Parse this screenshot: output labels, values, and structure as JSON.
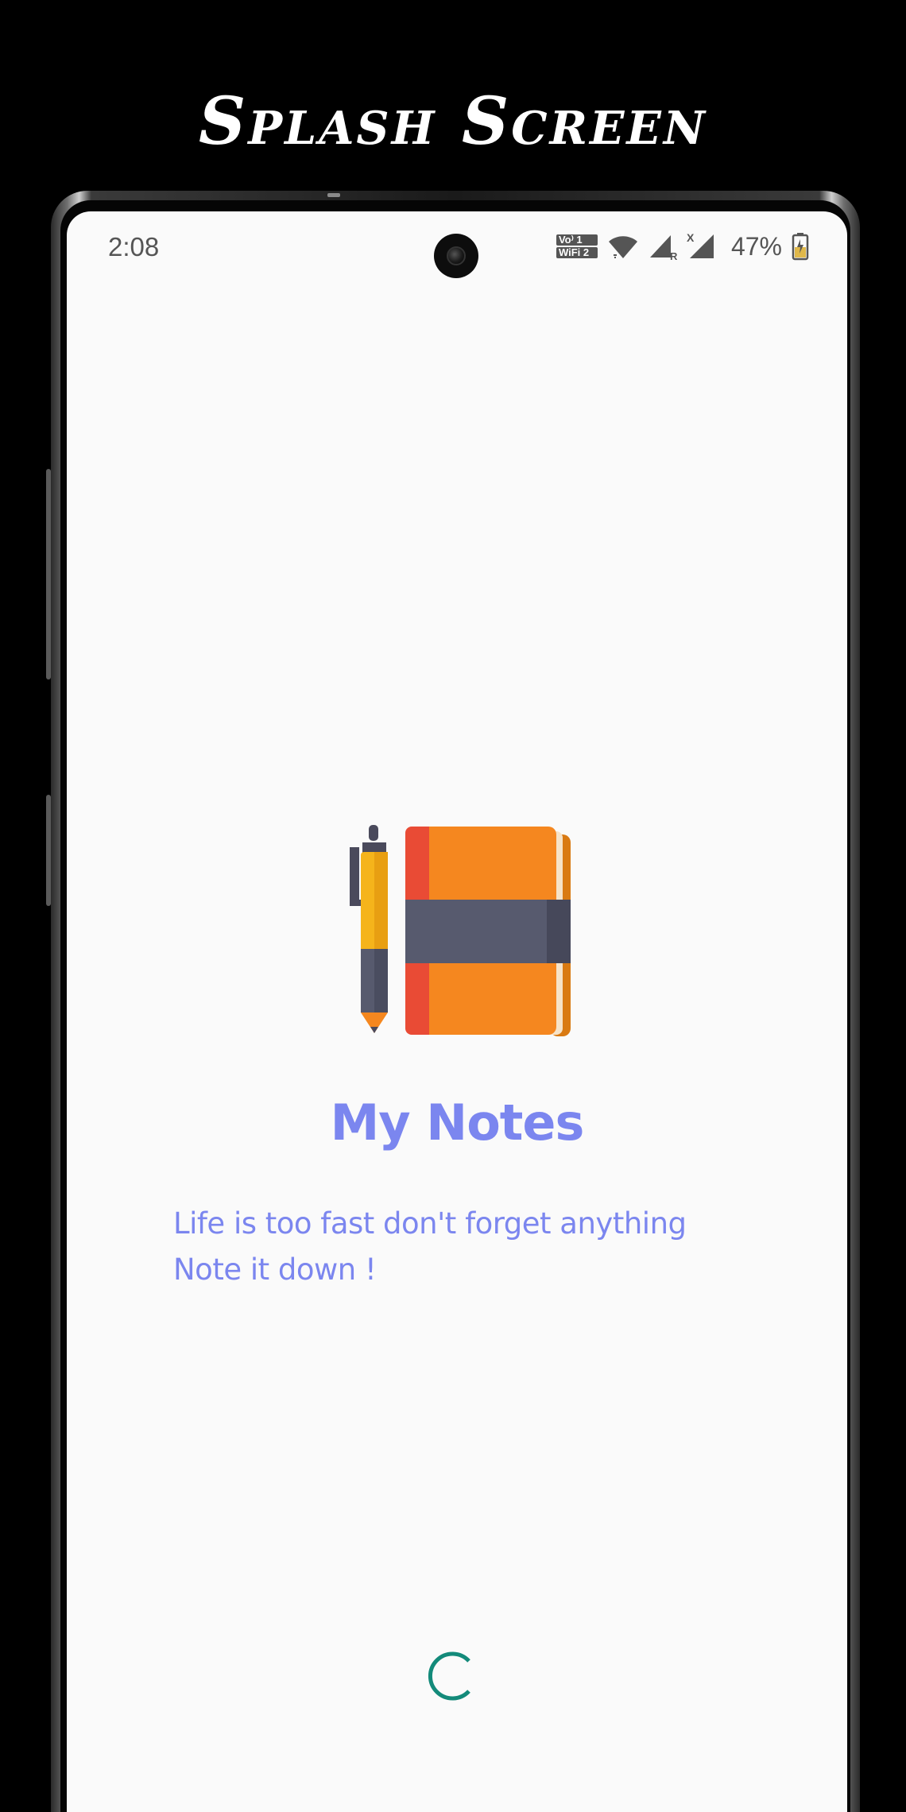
{
  "banner": {
    "title": "Splash Screen"
  },
  "status_bar": {
    "time": "2:08",
    "volte_line1": "Vo⁾ 1",
    "volte_line2": "WiFi 2",
    "battery_percent": "47%",
    "icons": [
      "camera-icon",
      "volte-wifi-icon",
      "wifi-icon",
      "signal-roaming-icon",
      "signal-no-data-icon",
      "battery-charging-icon"
    ]
  },
  "splash": {
    "app_name": "My Notes",
    "tagline_line1": "Life is too fast don't forget anything",
    "tagline_line2": "Note it down !",
    "logo_icon": "pen-and-notebook-icon",
    "loader_icon": "loading-spinner-icon"
  },
  "colors": {
    "accent": "#7b86ef",
    "screen_background": "#fafafa",
    "spinner": "#138a7a",
    "notebook_orange": "#f5871f",
    "notebook_spine": "#e94b35",
    "band": "#575a6e",
    "pen_yellow": "#f5b41b"
  }
}
